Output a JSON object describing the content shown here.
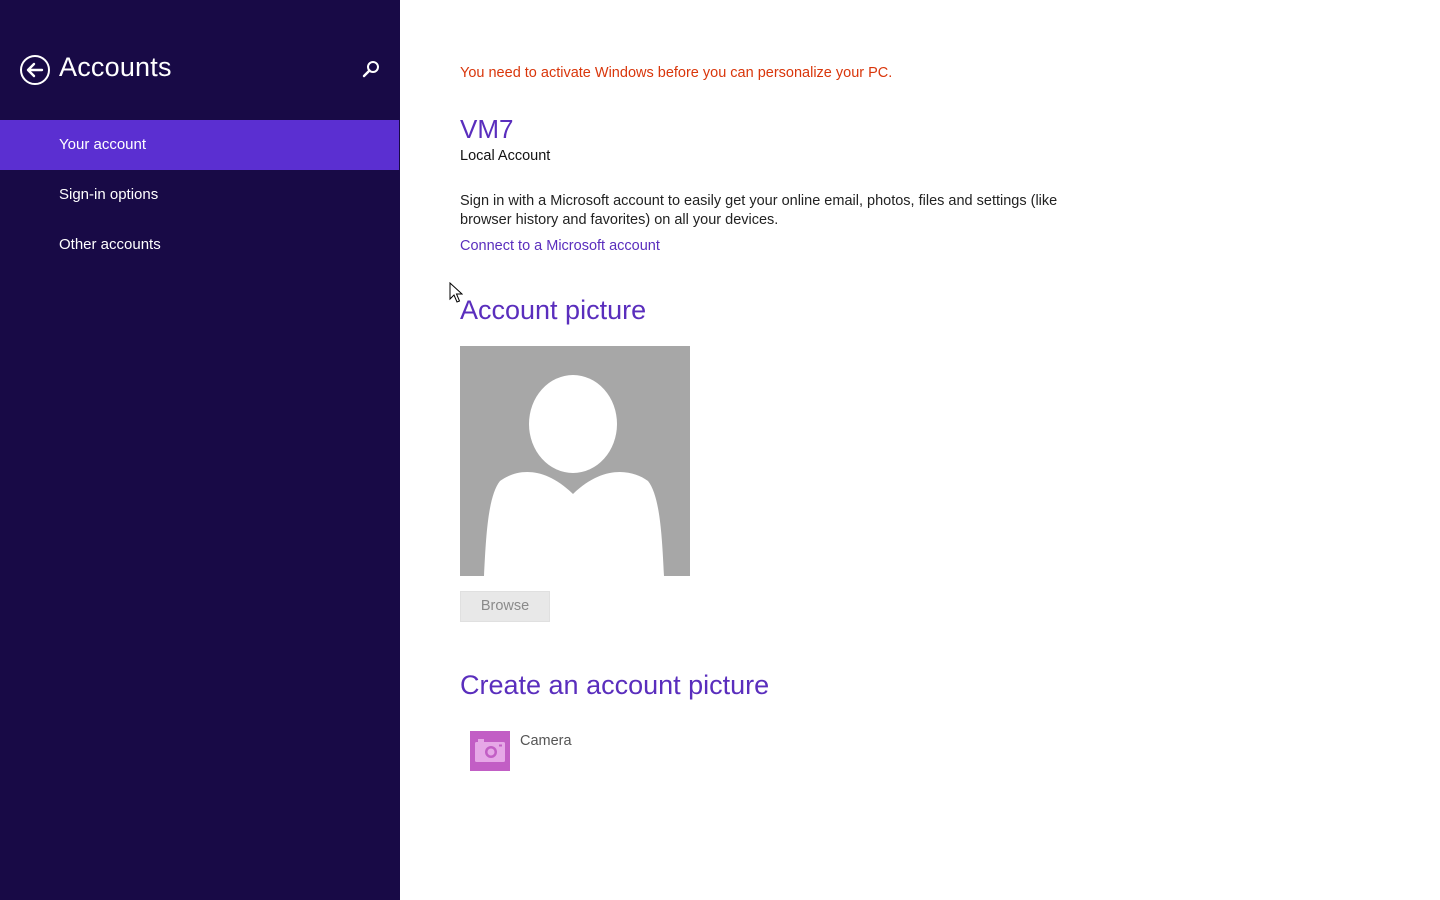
{
  "sidebar": {
    "title": "Accounts",
    "back_icon": "back-arrow-icon",
    "search_icon": "search-icon",
    "items": [
      {
        "label": "Your account",
        "selected": true
      },
      {
        "label": "Sign-in options",
        "selected": false
      },
      {
        "label": "Other accounts",
        "selected": false
      }
    ]
  },
  "main": {
    "activation_warning": "You need to activate Windows before you can personalize your PC.",
    "user_name": "VM7",
    "account_type": "Local Account",
    "description": "Sign in with a Microsoft account to easily get your online email, photos, files and settings (like browser history and favorites) on all your devices.",
    "connect_link": "Connect to a Microsoft account",
    "account_picture_heading": "Account picture",
    "browse_label": "Browse",
    "create_picture_heading": "Create an account picture",
    "camera_label": "Camera",
    "camera_icon": "camera-icon"
  },
  "colors": {
    "sidebar_bg": "#180a46",
    "selected_item_bg": "#5b2fd1",
    "accent_text": "#5a2ebd",
    "warning_text": "#d9360b",
    "camera_tile": "#c25ec5",
    "avatar_bg": "#a7a7a7"
  }
}
